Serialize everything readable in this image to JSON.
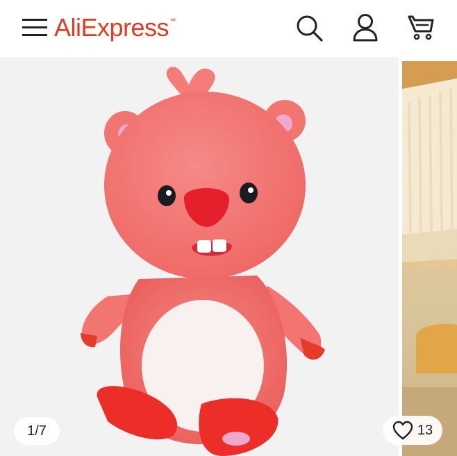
{
  "header": {
    "logo_text": "AliExpress",
    "logo_mark": "™",
    "brand_color": "#e43b1f",
    "icons": [
      "menu-icon",
      "search-icon",
      "user-icon",
      "cart-icon"
    ]
  },
  "gallery": {
    "counter": "1/7",
    "wishlist_count": "13",
    "current_image": 1,
    "total_images": 7
  },
  "product_image": {
    "subject": "pink plush beaver toy"
  }
}
